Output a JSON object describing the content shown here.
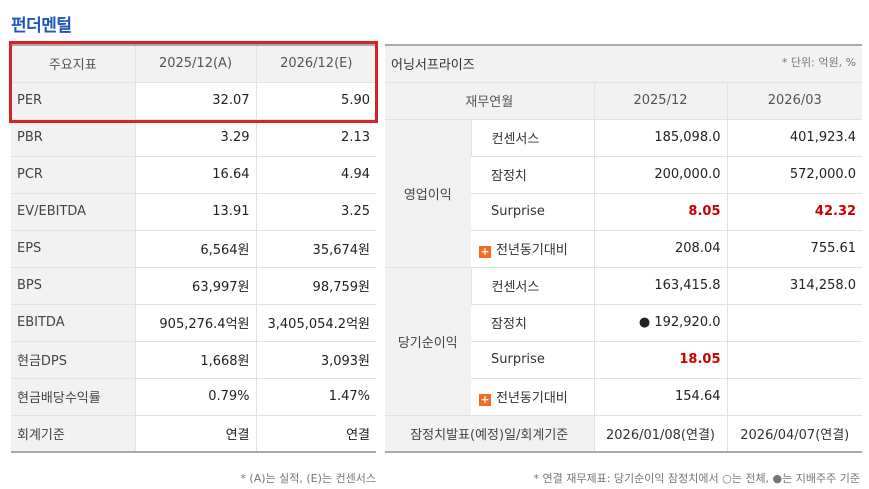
{
  "title": "펀더멘털",
  "left_table": {
    "headers": [
      "주요지표",
      "2025/12(A)",
      "2026/12(E)"
    ],
    "rows": [
      {
        "label": "PER",
        "v1": "32.07",
        "v2": "5.90"
      },
      {
        "label": "PBR",
        "v1": "3.29",
        "v2": "2.13"
      },
      {
        "label": "PCR",
        "v1": "16.64",
        "v2": "4.94"
      },
      {
        "label": "EV/EBITDA",
        "v1": "13.91",
        "v2": "3.25"
      },
      {
        "label": "EPS",
        "v1": "6,564원",
        "v2": "35,674원"
      },
      {
        "label": "BPS",
        "v1": "63,997원",
        "v2": "98,759원"
      },
      {
        "label": "EBITDA",
        "v1": "905,276.4억원",
        "v2": "3,405,054.2억원"
      },
      {
        "label": "현금DPS",
        "v1": "1,668원",
        "v2": "3,093원"
      },
      {
        "label": "현금배당수익률",
        "v1": "0.79%",
        "v2": "1.47%"
      },
      {
        "label": "회계기준",
        "v1": "연결",
        "v2": "연결"
      }
    ],
    "note": "* (A)는 실적, (E)는 컨센서스"
  },
  "right_table": {
    "title": "어닝서프라이즈",
    "unit": "* 단위: 억원, %",
    "sub_headers": [
      "재무연월",
      "2025/12",
      "2026/03"
    ],
    "groups": [
      {
        "name": "영업이익",
        "rows": [
          {
            "item": "컨센서스",
            "v1": "185,098.0",
            "v2": "401,923.4"
          },
          {
            "item": "잠정치",
            "v1": "200,000.0",
            "v2": "572,000.0"
          },
          {
            "item": "Surprise",
            "v1": "8.05",
            "v2": "42.32"
          },
          {
            "item": "전년동기대비",
            "v1": "208.04",
            "v2": "755.61"
          }
        ]
      },
      {
        "name": "당기순이익",
        "rows": [
          {
            "item": "컨센서스",
            "v1": "163,415.8",
            "v2": "314,258.0"
          },
          {
            "item": "잠정치",
            "v1": "● 192,920.0",
            "v2": ""
          },
          {
            "item": "Surprise",
            "v1": "18.05",
            "v2": ""
          },
          {
            "item": "전년동기대비",
            "v1": "154.64",
            "v2": ""
          }
        ]
      }
    ],
    "footer": {
      "label": "잠정치발표(예정)일/회계기준",
      "v1": "2026/01/08(연결)",
      "v2": "2026/04/07(연결)"
    },
    "note": "* 연결 재무제표: 당기순이익 잠정치에서 ○는 전체, ●는 지배주주 기준"
  },
  "colors": {
    "title": "#1f57b7",
    "highlight_box": "#d8222a",
    "surprise": "#cc0000",
    "plus_icon": "#f36b21"
  }
}
